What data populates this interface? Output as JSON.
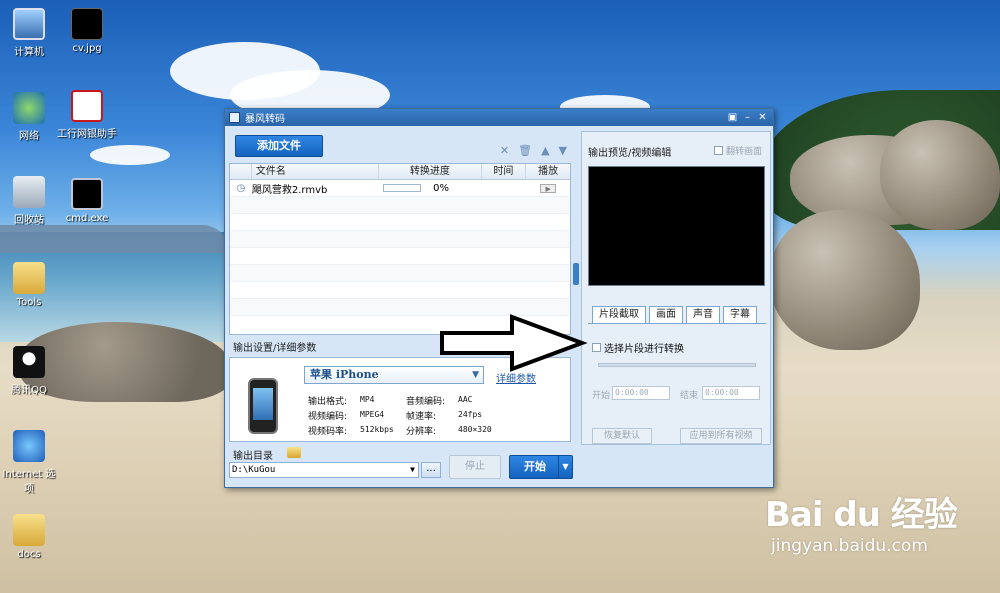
{
  "desktop": {
    "icons": [
      {
        "label": "计算机",
        "icon": "computer-icon"
      },
      {
        "label": "cv.jpg",
        "icon": "image-file-icon"
      },
      {
        "label": "网络",
        "icon": "network-icon"
      },
      {
        "label": "工行网银助手",
        "icon": "icbc-bank-icon"
      },
      {
        "label": "回收站",
        "icon": "recycle-bin-icon"
      },
      {
        "label": "cmd.exe",
        "icon": "cmd-icon"
      },
      {
        "label": "Tools",
        "icon": "folder-icon"
      },
      {
        "label": "腾讯QQ",
        "icon": "qq-icon"
      },
      {
        "label": "Internet 选项",
        "icon": "ie-icon"
      },
      {
        "label": "docs",
        "icon": "folder-icon"
      }
    ]
  },
  "window": {
    "title": "暴风转码",
    "toolbar": {
      "add_file": "添加文件"
    },
    "list": {
      "columns": [
        "文件名",
        "转换进度",
        "时间",
        "播放"
      ],
      "rows": [
        {
          "name": "飓风营救2.rmvb",
          "progress": 0,
          "progress_text": "0%",
          "time": ""
        }
      ]
    },
    "output_settings": {
      "label": "输出设置/详细参数",
      "device": "苹果 iPhone",
      "detail_link": "详细参数",
      "params": [
        {
          "k": "输出格式:",
          "v": "MP4"
        },
        {
          "k": "音频编码:",
          "v": "AAC"
        },
        {
          "k": "视频编码:",
          "v": "MPEG4"
        },
        {
          "k": "帧速率:",
          "v": "24fps"
        },
        {
          "k": "视频码率:",
          "v": "512kbps"
        },
        {
          "k": "分辨率:",
          "v": "480×320"
        }
      ]
    },
    "output_dir": {
      "label": "输出目录",
      "value": "D:\\KuGou",
      "browse": "..."
    },
    "buttons": {
      "stop": "停止",
      "start": "开始"
    },
    "preview": {
      "label": "输出预览/视频编辑",
      "flip": "翻转画面",
      "tabs": [
        "片段截取",
        "画面",
        "声音",
        "字幕"
      ],
      "segment_checkbox": "选择片段进行转换",
      "start_label": "开始",
      "start_time": "0:00:00",
      "end_label": "结束",
      "end_time": "0:00:00",
      "restore_default": "恢复默认",
      "apply_all": "应用到所有视频"
    }
  },
  "watermark": {
    "logo": "Bai du 经验",
    "url": "jingyan.baidu.com"
  }
}
